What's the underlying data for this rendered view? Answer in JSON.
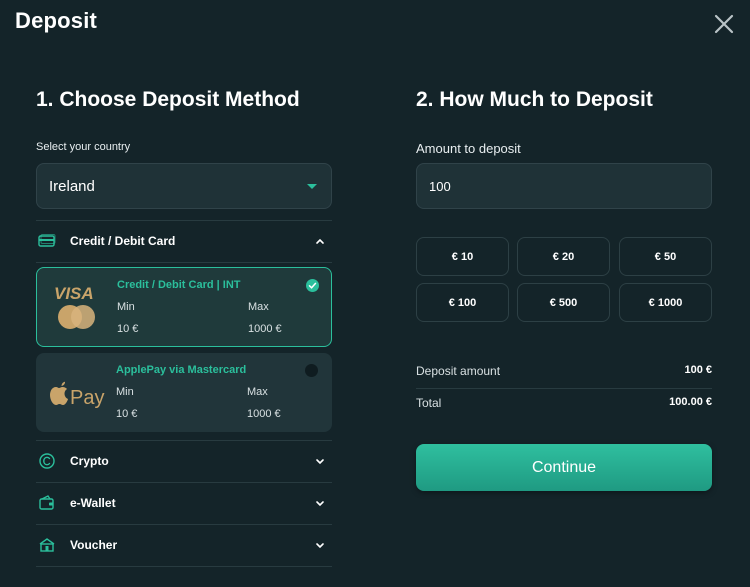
{
  "header": {
    "title": "Deposit"
  },
  "method_section": {
    "title": "1. Choose Deposit Method",
    "country_label": "Select your country",
    "country_value": "Ireland"
  },
  "categories": [
    {
      "label": "Credit / Debit Card",
      "icon": "card-icon",
      "expanded": true
    },
    {
      "label": "Crypto",
      "icon": "crypto-icon",
      "expanded": false
    },
    {
      "label": "e-Wallet",
      "icon": "wallet-icon",
      "expanded": false
    },
    {
      "label": "Voucher",
      "icon": "voucher-icon",
      "expanded": false
    }
  ],
  "methods": [
    {
      "name": "Credit / Debit Card | INT",
      "logo_text": "VISA",
      "min_label": "Min",
      "max_label": "Max",
      "min_value": "10 €",
      "max_value": "1000 €",
      "selected": true
    },
    {
      "name": "ApplePay via Mastercard",
      "logo_text": "Pay",
      "min_label": "Min",
      "max_label": "Max",
      "min_value": "10 €",
      "max_value": "1000 €",
      "selected": false
    }
  ],
  "amount_section": {
    "title": "2. How Much to Deposit",
    "amount_label": "Amount to deposit",
    "amount_value": "100",
    "presets": [
      "€ 10",
      "€ 20",
      "€ 50",
      "€ 100",
      "€ 500",
      "€ 1000"
    ]
  },
  "summary": {
    "deposit_label": "Deposit amount",
    "deposit_value": "100 €",
    "total_label": "Total",
    "total_value": "100.00 €"
  },
  "continue_label": "Continue",
  "colors": {
    "background": "#142429",
    "accent": "#2bbf9c",
    "field": "#1f3237"
  }
}
